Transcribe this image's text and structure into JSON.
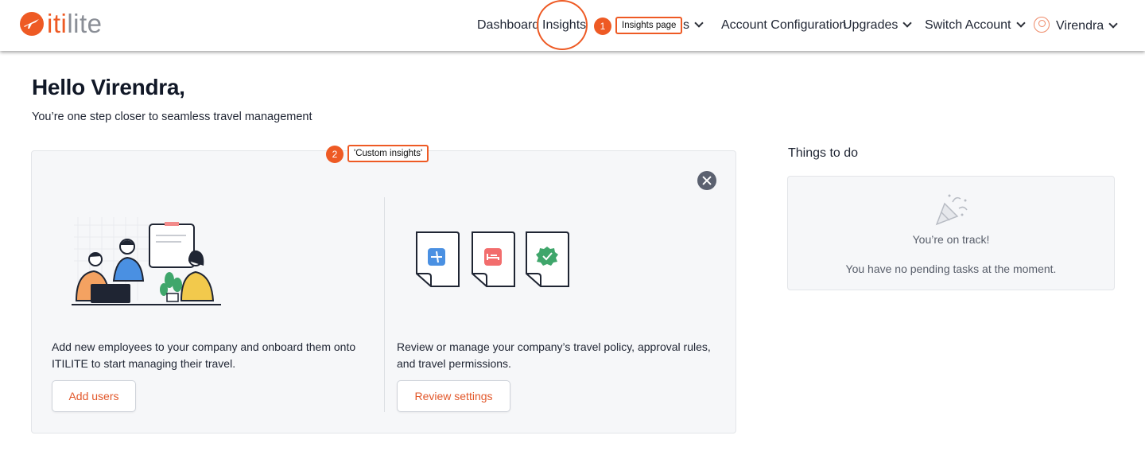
{
  "brand": {
    "prefix": "iti",
    "suffix": "lite",
    "accent": "#ee5a24"
  },
  "nav": {
    "dashboard": "Dashboard",
    "insights": "Insights",
    "hidden_item_tail": "s",
    "account_configuration": "Account Configuration",
    "upgrades": "Upgrades",
    "switch_account": "Switch Account",
    "user": "Virendra"
  },
  "annotations": {
    "step1": {
      "number": "1",
      "label": "Insights page"
    },
    "step2": {
      "number": "2",
      "label": "'Custom insights'"
    }
  },
  "greeting": {
    "title": "Hello Virendra,",
    "subtitle": "You’re one step closer to seamless travel management"
  },
  "onboarding": {
    "users": {
      "text": "Add new employees to your company and onboard them onto ITILITE to start managing their travel.",
      "button": "Add users"
    },
    "settings": {
      "text": "Review or manage your company’s travel policy, approval rules, and travel permissions.",
      "button": "Review settings"
    }
  },
  "todo": {
    "heading": "Things to do",
    "status": "You’re on track!",
    "message": "You have no pending tasks at the moment."
  },
  "icons": [
    "close-icon",
    "chevron-down-icon",
    "user-avatar-icon",
    "airplane-icon",
    "hotel-bed-icon",
    "check-badge-icon",
    "party-popper-icon"
  ]
}
